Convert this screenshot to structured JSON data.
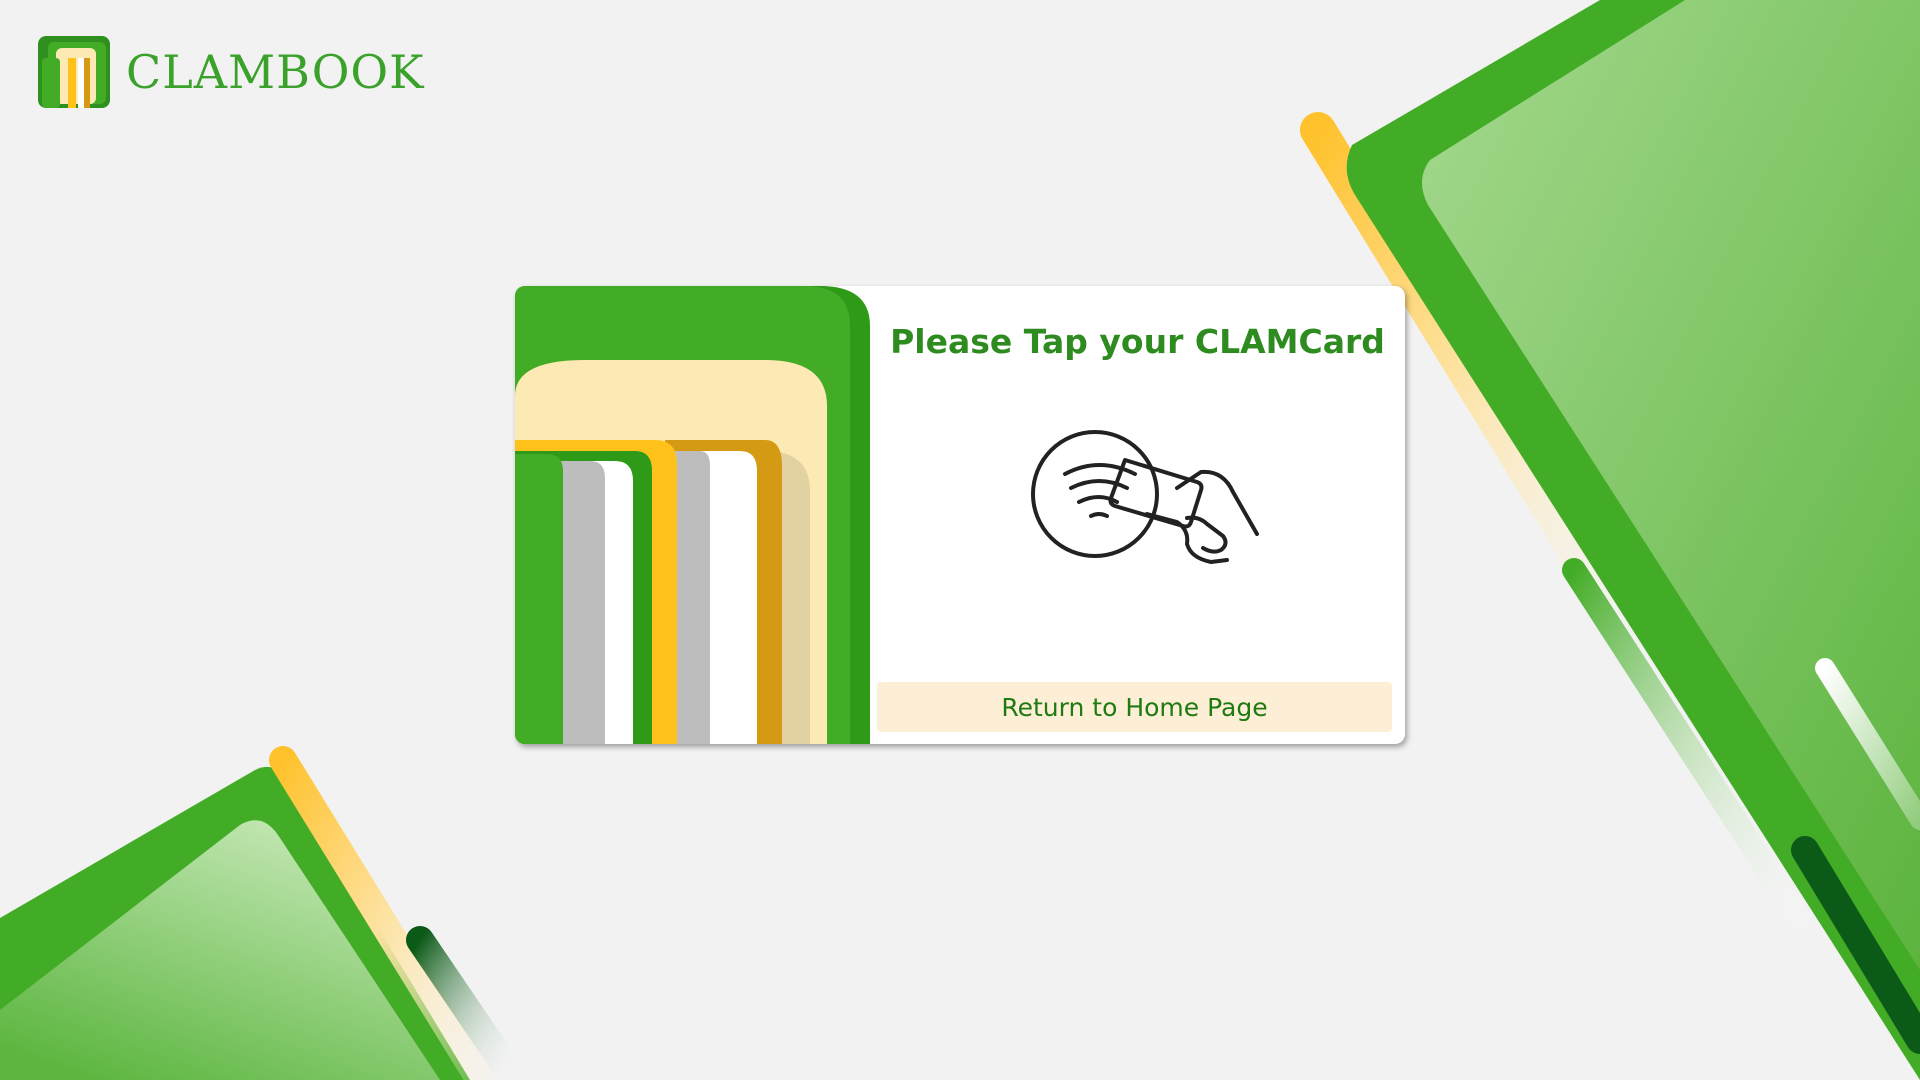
{
  "brand": {
    "name": "CLAMBOOK",
    "logo_icon": "clambook-logo-icon",
    "accent_color": "#3aa22a"
  },
  "card": {
    "title": "Please Tap your CLAMCard",
    "illustration_icon": "tap-card-icon",
    "return_button_label": "Return to Home Page"
  },
  "colors": {
    "primary_green": "#43ac26",
    "yellow": "#ffc21a",
    "cream": "#fde9b4",
    "button_bg": "#fdefd6",
    "title_green": "#2e8b1f"
  }
}
